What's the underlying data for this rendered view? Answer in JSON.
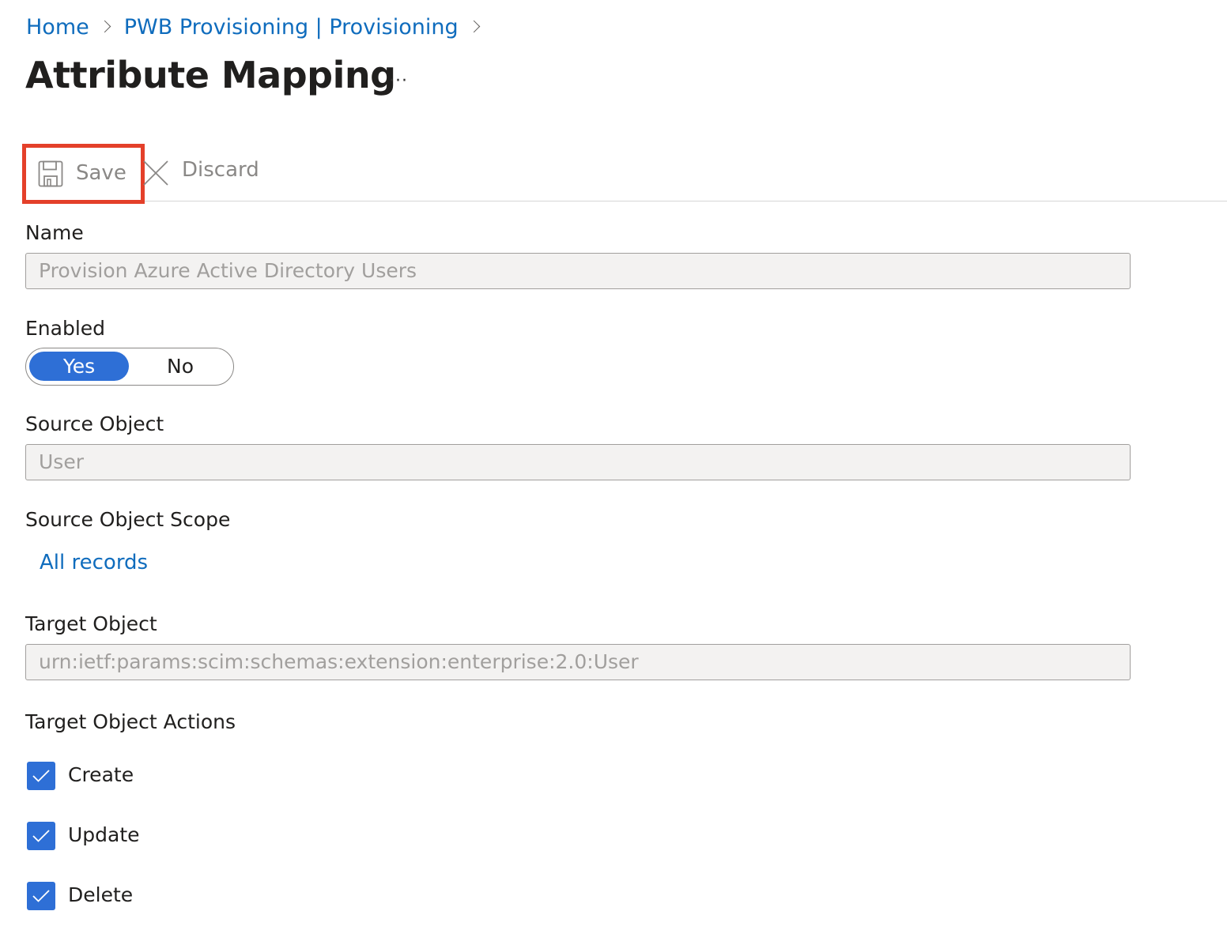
{
  "breadcrumb": {
    "items": [
      {
        "label": "Home"
      },
      {
        "label": "PWB Provisioning | Provisioning"
      }
    ]
  },
  "header": {
    "title": "Attribute Mapping",
    "more_label": "···"
  },
  "toolbar": {
    "save_label": "Save",
    "discard_label": "Discard",
    "save_icon": "save-icon",
    "discard_icon": "close-icon"
  },
  "form": {
    "name": {
      "label": "Name",
      "value": "Provision Azure Active Directory Users"
    },
    "enabled": {
      "label": "Enabled",
      "options": [
        "Yes",
        "No"
      ],
      "selected": "Yes"
    },
    "source_object": {
      "label": "Source Object",
      "value": "User"
    },
    "source_object_scope": {
      "label": "Source Object Scope",
      "link": "All records"
    },
    "target_object": {
      "label": "Target Object",
      "value": "urn:ietf:params:scim:schemas:extension:enterprise:2.0:User"
    },
    "target_object_actions": {
      "label": "Target Object Actions",
      "items": [
        {
          "label": "Create",
          "checked": true
        },
        {
          "label": "Update",
          "checked": true
        },
        {
          "label": "Delete",
          "checked": true
        }
      ]
    }
  },
  "colors": {
    "accent": "#2e6fd6",
    "link": "#0f6cbd",
    "highlight": "#e4402a"
  }
}
